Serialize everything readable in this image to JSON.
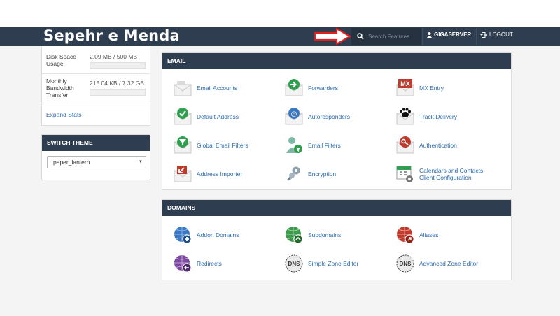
{
  "header": {
    "brand": "Sepehr e Menda",
    "search_placeholder": "Search Features",
    "user_label": "GIGASERVER",
    "logout_label": "LOGOUT"
  },
  "stats": {
    "rows": [
      {
        "label": "Disk Space Usage",
        "value": "2.09 MB / 500 MB"
      },
      {
        "label": "Monthly Bandwidth Transfer",
        "value": "215.04 KB / 7.32 GB"
      }
    ],
    "expand_label": "Expand Stats"
  },
  "theme": {
    "title": "SWITCH THEME",
    "selected": "paper_lantern"
  },
  "email": {
    "title": "EMAIL",
    "items": [
      {
        "label": "Email Accounts",
        "icon": "email-accounts-icon"
      },
      {
        "label": "Forwarders",
        "icon": "forwarders-icon"
      },
      {
        "label": "MX Entry",
        "icon": "mx-entry-icon"
      },
      {
        "label": "Default Address",
        "icon": "default-address-icon"
      },
      {
        "label": "Autoresponders",
        "icon": "autoresponders-icon"
      },
      {
        "label": "Track Delivery",
        "icon": "track-delivery-icon"
      },
      {
        "label": "Global Email Filters",
        "icon": "global-filters-icon"
      },
      {
        "label": "Email Filters",
        "icon": "email-filters-icon"
      },
      {
        "label": "Authentication",
        "icon": "authentication-icon"
      },
      {
        "label": "Address Importer",
        "icon": "address-importer-icon"
      },
      {
        "label": "Encryption",
        "icon": "encryption-icon"
      },
      {
        "label": "Calendars and Contacts",
        "label2": "Client Configuration",
        "icon": "calendars-icon"
      }
    ]
  },
  "domains": {
    "title": "DOMAINS",
    "items": [
      {
        "label": "Addon Domains",
        "icon": "addon-domains-icon"
      },
      {
        "label": "Subdomains",
        "icon": "subdomains-icon"
      },
      {
        "label": "Aliases",
        "icon": "aliases-icon"
      },
      {
        "label": "Redirects",
        "icon": "redirects-icon"
      },
      {
        "label": "Simple Zone Editor",
        "icon": "simple-zone-icon",
        "badge": "DNS"
      },
      {
        "label": "Advanced Zone Editor",
        "icon": "advanced-zone-icon",
        "badge": "DNS"
      }
    ]
  },
  "colors": {
    "navbar": "#2e3e50",
    "link": "#2a6bb0",
    "annotation_arrow": "#e02020"
  }
}
